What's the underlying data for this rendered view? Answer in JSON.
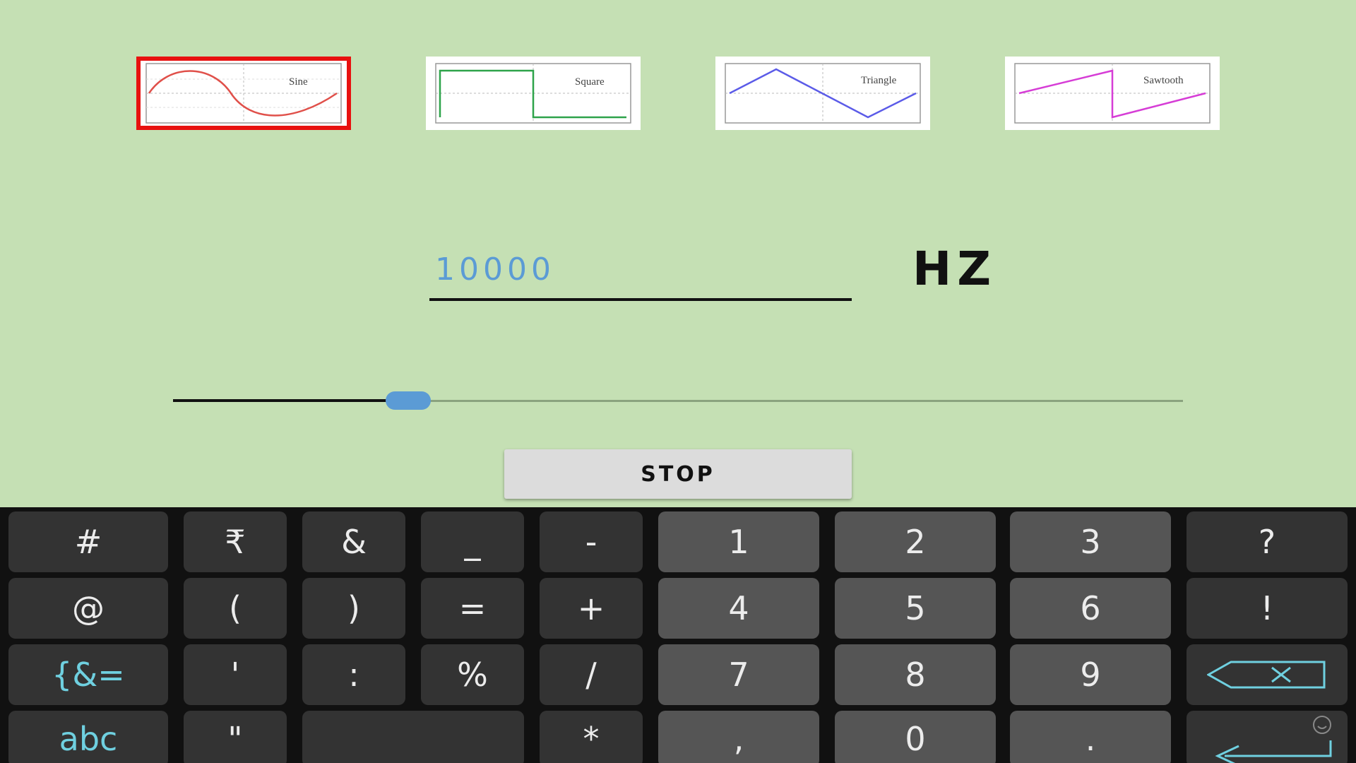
{
  "colors": {
    "background": "#c5e0b4",
    "selected_border": "#e8110f",
    "input_text": "#5b9bd5",
    "slider_thumb": "#5b9bd5",
    "key_dark": "#333333",
    "key_num": "#555555",
    "key_accent": "#6fd0e0"
  },
  "waveforms": [
    {
      "id": "sine",
      "label": "Sine",
      "color": "#e0504a",
      "selected": true
    },
    {
      "id": "square",
      "label": "Square",
      "color": "#2ea34a",
      "selected": false
    },
    {
      "id": "triangle",
      "label": "Triangle",
      "color": "#5b5be8",
      "selected": false
    },
    {
      "id": "sawtooth",
      "label": "Sawtooth",
      "color": "#d63dd6",
      "selected": false
    }
  ],
  "frequency": {
    "value": "10000",
    "unit": "HZ"
  },
  "slider": {
    "value_fraction": 0.233
  },
  "stop_button": {
    "label": "STOP"
  },
  "keyboard": {
    "rows": [
      [
        "#",
        "₹",
        "&",
        "_",
        "-",
        "1",
        "2",
        "3",
        "?"
      ],
      [
        "@",
        "(",
        ")",
        "=",
        "+",
        "4",
        "5",
        "6",
        "!"
      ],
      [
        "{&=",
        "'",
        ":",
        "%",
        "/",
        "7",
        "8",
        "9",
        "backspace-icon"
      ],
      [
        "abc",
        "\"",
        "space",
        "*",
        ",",
        "0",
        ".",
        "enter-icon"
      ]
    ]
  }
}
